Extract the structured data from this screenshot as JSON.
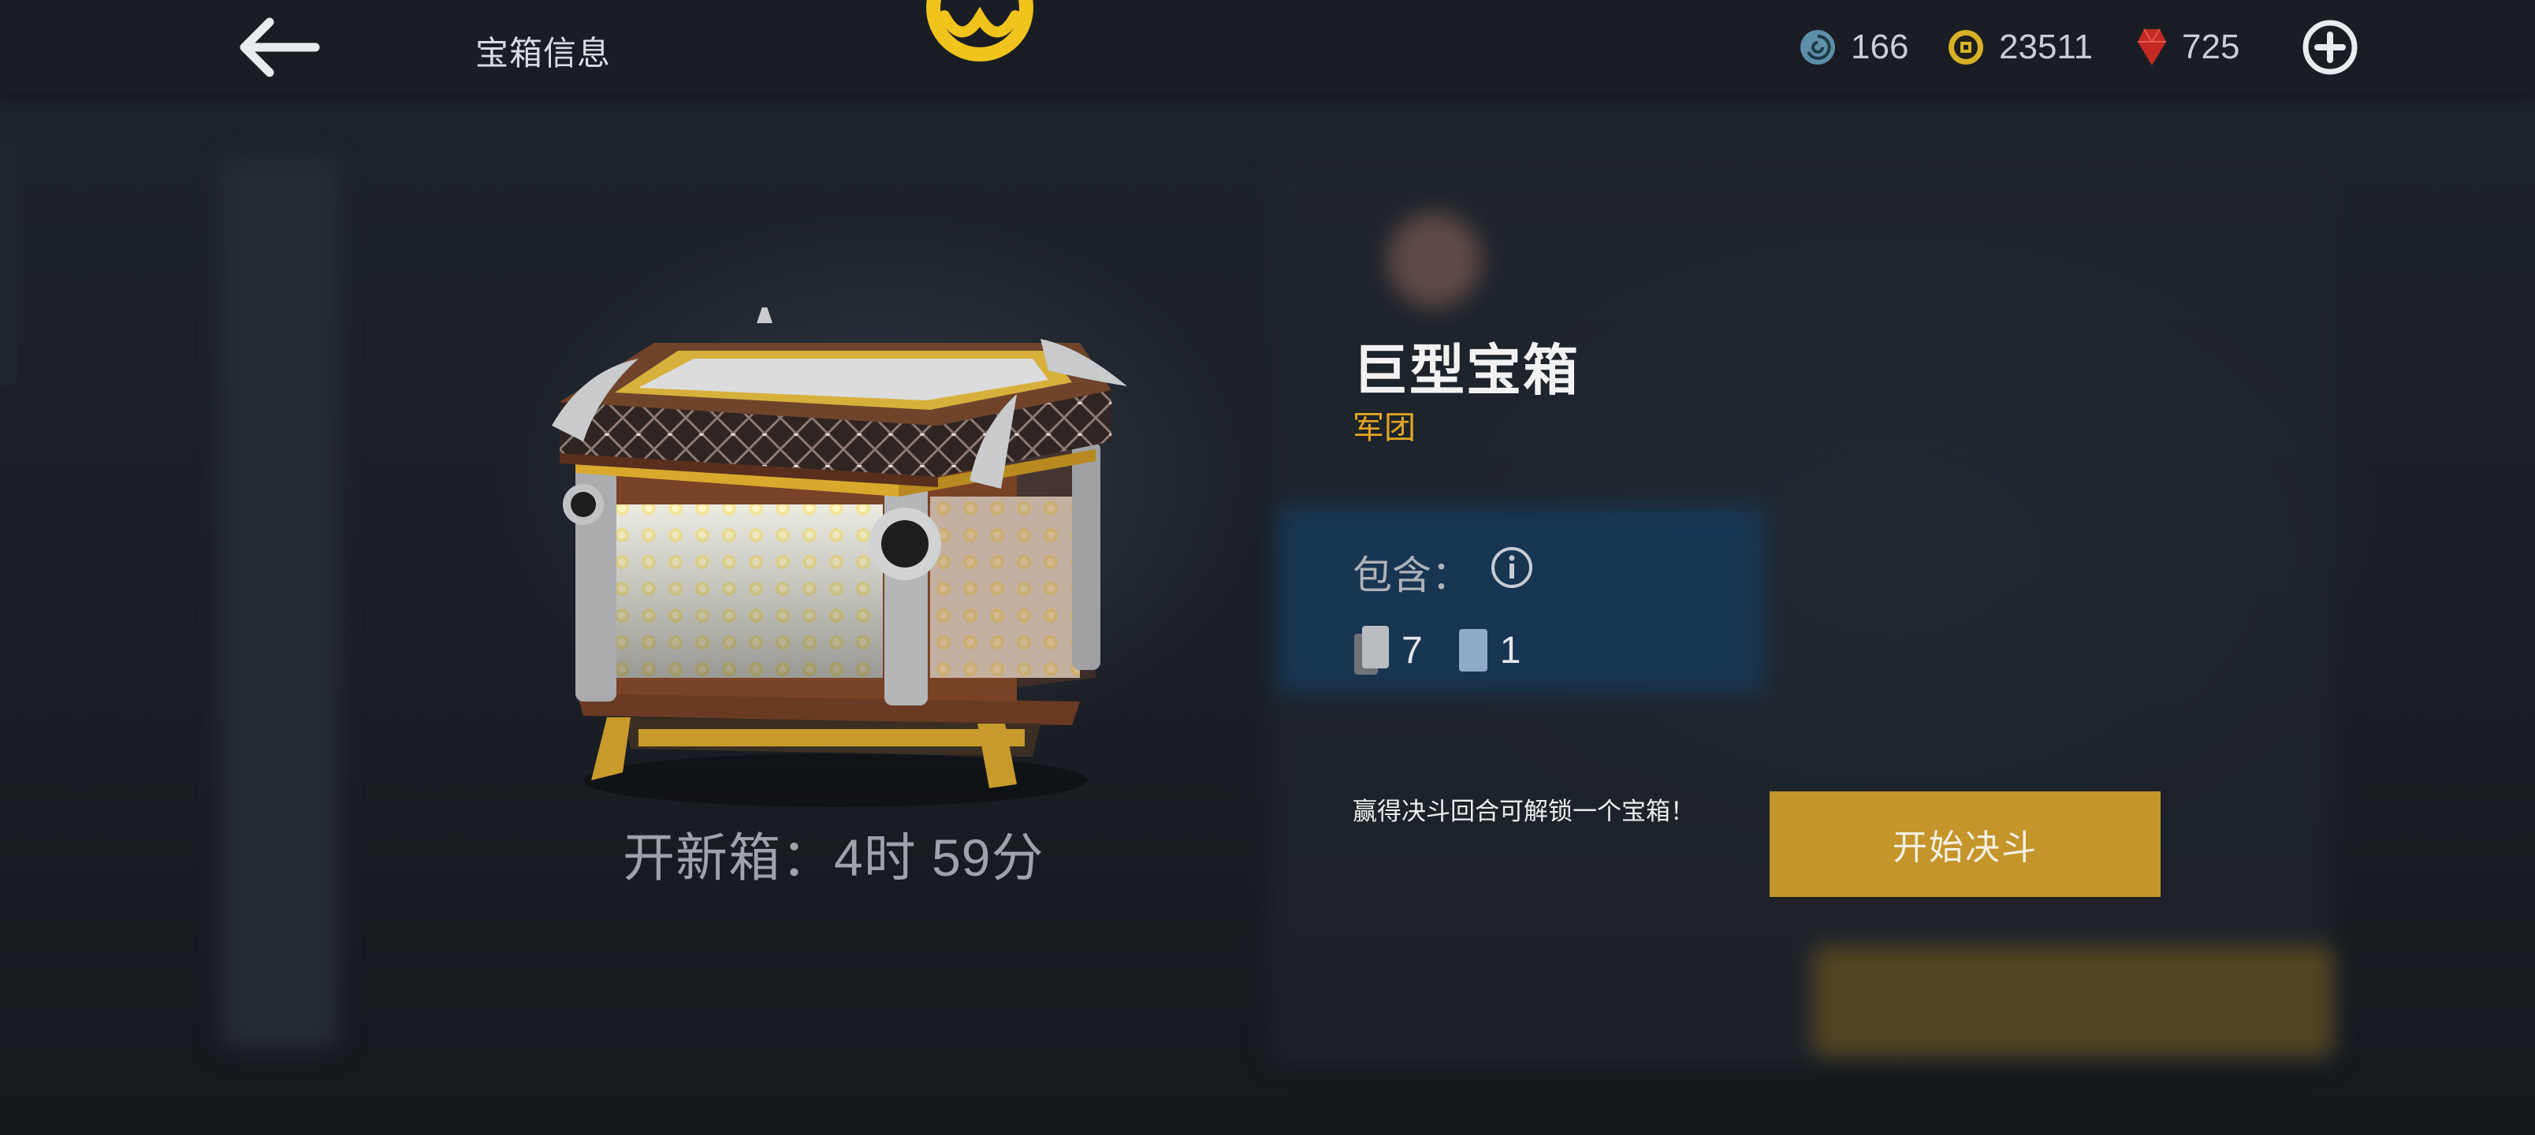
{
  "header": {
    "title": "宝箱信息",
    "back_icon": "arrow-left-icon",
    "logo_icon": "faction-emblem-icon"
  },
  "currencies": [
    {
      "icon": "spiral-token-icon",
      "value": "166"
    },
    {
      "icon": "coin-icon",
      "value": "23511"
    },
    {
      "icon": "gem-icon",
      "value": "725"
    }
  ],
  "add_icon": "plus-circle-icon",
  "chest": {
    "name": "巨型宝箱",
    "rarity": "军团",
    "timer_text": "开新箱：4时 59分",
    "contains_label": "包含：",
    "cards": [
      {
        "icon": "card-stack-icon",
        "count": "7"
      },
      {
        "icon": "blue-card-icon",
        "count": "1"
      }
    ]
  },
  "duel": {
    "hint": "赢得决斗回合可解锁一个宝箱！",
    "button_label": "开始决斗"
  },
  "colors": {
    "accent_gold": "#c4952a",
    "rarity_gold": "#e2a624",
    "topbar": "#1a1e24"
  }
}
